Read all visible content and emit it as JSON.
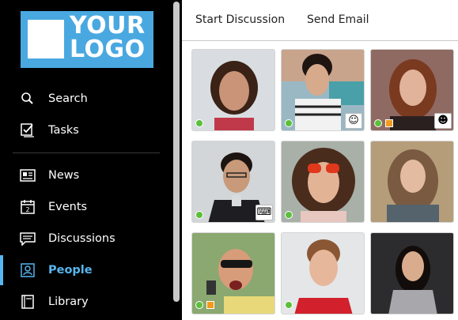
{
  "logo": {
    "line1": "YOUR",
    "line2": "LOGO"
  },
  "sidebar": {
    "items": [
      {
        "label": "Search",
        "icon": "search-icon"
      },
      {
        "label": "Tasks",
        "icon": "tasks-icon"
      },
      {
        "label": "News",
        "icon": "news-icon"
      },
      {
        "label": "Events",
        "icon": "calendar-icon"
      },
      {
        "label": "Discussions",
        "icon": "chat-icon"
      },
      {
        "label": "People",
        "icon": "person-icon"
      },
      {
        "label": "Library",
        "icon": "book-icon"
      }
    ],
    "active": "People",
    "accent_color": "#56b6f0"
  },
  "topbar": {
    "tabs": [
      {
        "label": "Start Discussion"
      },
      {
        "label": "Send Email"
      }
    ]
  },
  "people": [
    {
      "status": "online",
      "badge": null
    },
    {
      "status": "online",
      "badge": "emoji-icon"
    },
    {
      "status": "online",
      "badge": "avatar-icon",
      "secondary_status": "away"
    },
    {
      "status": "online",
      "badge": "keyboard-icon"
    },
    {
      "status": "online",
      "badge": null
    },
    {
      "status": null,
      "badge": null
    },
    {
      "status": "online",
      "badge": null,
      "secondary_status": "away"
    },
    {
      "status": "online",
      "badge": null
    },
    {
      "status": null,
      "badge": null
    }
  ],
  "colors": {
    "online": "#5bbf3a",
    "away": "#f39a1c",
    "logo_bg": "#4aa8e0"
  }
}
